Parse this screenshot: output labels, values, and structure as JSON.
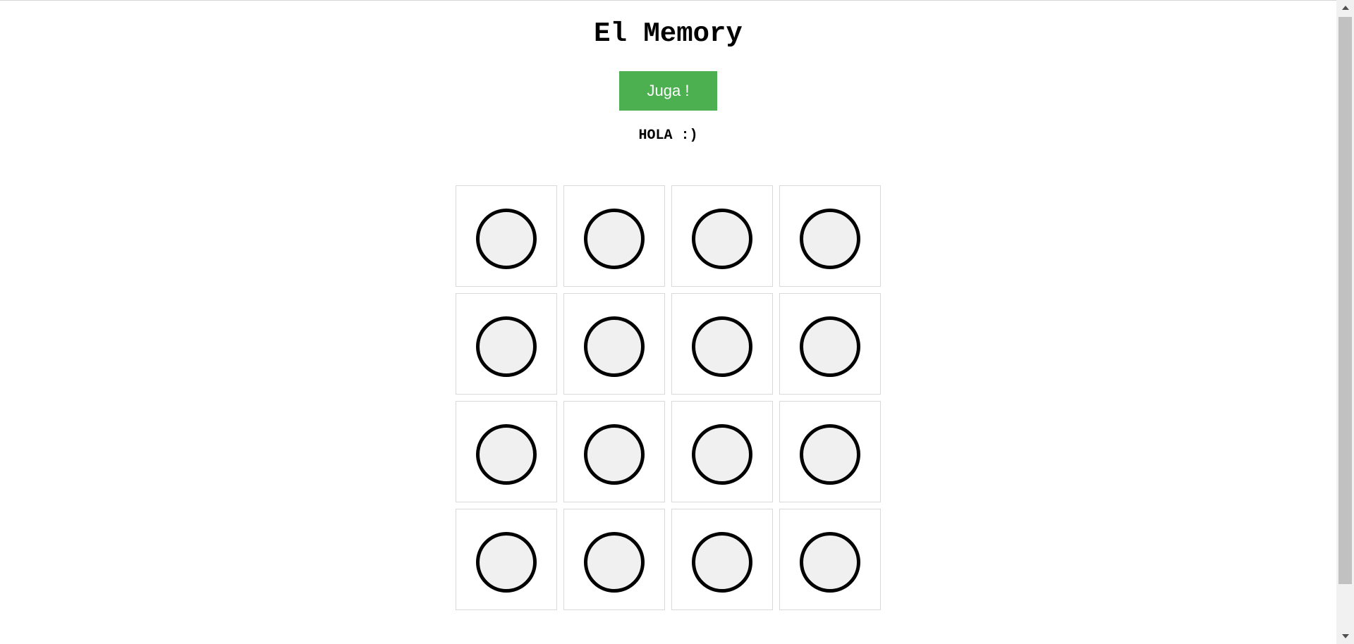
{
  "header": {
    "title": "El Memory",
    "play_button_label": "Juga !",
    "message": "HOLA :)"
  },
  "board": {
    "rows": 4,
    "columns": 4,
    "cards": [
      {
        "state": "face-down"
      },
      {
        "state": "face-down"
      },
      {
        "state": "face-down"
      },
      {
        "state": "face-down"
      },
      {
        "state": "face-down"
      },
      {
        "state": "face-down"
      },
      {
        "state": "face-down"
      },
      {
        "state": "face-down"
      },
      {
        "state": "face-down"
      },
      {
        "state": "face-down"
      },
      {
        "state": "face-down"
      },
      {
        "state": "face-down"
      },
      {
        "state": "face-down"
      },
      {
        "state": "face-down"
      },
      {
        "state": "face-down"
      },
      {
        "state": "face-down"
      }
    ]
  },
  "colors": {
    "play_button": "#4caf50",
    "card_back_fill": "#f0f0f0",
    "card_back_ring": "#000000",
    "card_border": "#d9d9d9"
  },
  "icons": {
    "card_back": "circle-icon",
    "scroll_up": "triangle-up-icon",
    "scroll_down": "triangle-down-icon"
  }
}
